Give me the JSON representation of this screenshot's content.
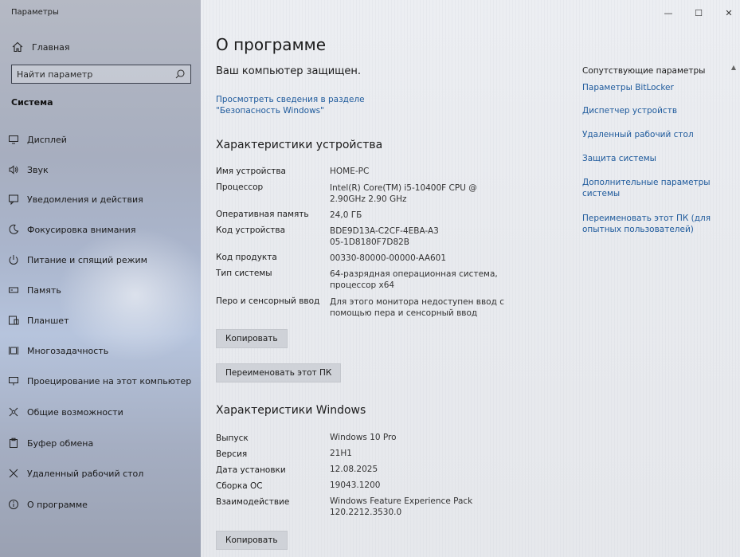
{
  "window": {
    "title": "Параметры",
    "controls": {
      "minimize": "—",
      "maximize": "☐",
      "close": "✕"
    }
  },
  "sidebar": {
    "home_label": "Главная",
    "search_placeholder": "Найти параметр",
    "section_title": "Система",
    "items": [
      {
        "label": "Дисплей",
        "icon": "display-icon"
      },
      {
        "label": "Звук",
        "icon": "sound-icon"
      },
      {
        "label": "Уведомления и действия",
        "icon": "notifications-icon"
      },
      {
        "label": "Фокусировка внимания",
        "icon": "focus-assist-icon"
      },
      {
        "label": "Питание и спящий режим",
        "icon": "power-icon"
      },
      {
        "label": "Память",
        "icon": "storage-icon"
      },
      {
        "label": "Планшет",
        "icon": "tablet-icon"
      },
      {
        "label": "Многозадачность",
        "icon": "multitasking-icon"
      },
      {
        "label": "Проецирование на этот компьютер",
        "icon": "projecting-icon"
      },
      {
        "label": "Общие возможности",
        "icon": "shared-experiences-icon"
      },
      {
        "label": "Буфер обмена",
        "icon": "clipboard-icon"
      },
      {
        "label": "Удаленный рабочий стол",
        "icon": "remote-desktop-icon"
      },
      {
        "label": "О программе",
        "icon": "info-icon"
      }
    ]
  },
  "main": {
    "title": "О программе",
    "protected_text": "Ваш компьютер защищен.",
    "security_link": "Просмотреть сведения в разделе \"Безопасность Windows\"",
    "device_specs": {
      "heading": "Характеристики устройства",
      "rows": [
        {
          "label": "Имя устройства",
          "value": "HOME-PC"
        },
        {
          "label": "Процессор",
          "value": "Intel(R) Core(TM) i5-10400F CPU @ 2.90GHz   2.90 GHz"
        },
        {
          "label": "Оперативная память",
          "value": "24,0 ГБ"
        },
        {
          "label": "Код устройства",
          "value": "BDE9D13A-C2CF-4EBA-A305-1D8180F7D82B"
        },
        {
          "label": "Код продукта",
          "value": "00330-80000-00000-AA601"
        },
        {
          "label": "Тип системы",
          "value": "64-разрядная операционная система, процессор x64"
        },
        {
          "label": "Перо и сенсорный ввод",
          "value": "Для этого монитора недоступен ввод с помощью пера и сенсорный ввод"
        }
      ],
      "copy_button": "Копировать",
      "rename_button": "Переименовать этот ПК"
    },
    "windows_specs": {
      "heading": "Характеристики Windows",
      "rows": [
        {
          "label": "Выпуск",
          "value": "Windows 10 Pro"
        },
        {
          "label": "Версия",
          "value": "21H1"
        },
        {
          "label": "Дата установки",
          "value": "12.08.2025"
        },
        {
          "label": "Сборка ОС",
          "value": "19043.1200"
        },
        {
          "label": "Взаимодействие",
          "value": "Windows Feature Experience Pack 120.2212.3530.0"
        }
      ],
      "copy_button": "Копировать"
    }
  },
  "related": {
    "title": "Сопутствующие параметры",
    "links": [
      "Параметры BitLocker",
      "Диспетчер устройств",
      "Удаленный рабочий стол",
      "Защита системы",
      "Дополнительные параметры системы",
      "Переименовать этот ПК (для опытных пользователей)"
    ]
  },
  "colors": {
    "link": "#1e5a9c",
    "text": "#1b1b1b",
    "button": "#cfd2d8"
  }
}
